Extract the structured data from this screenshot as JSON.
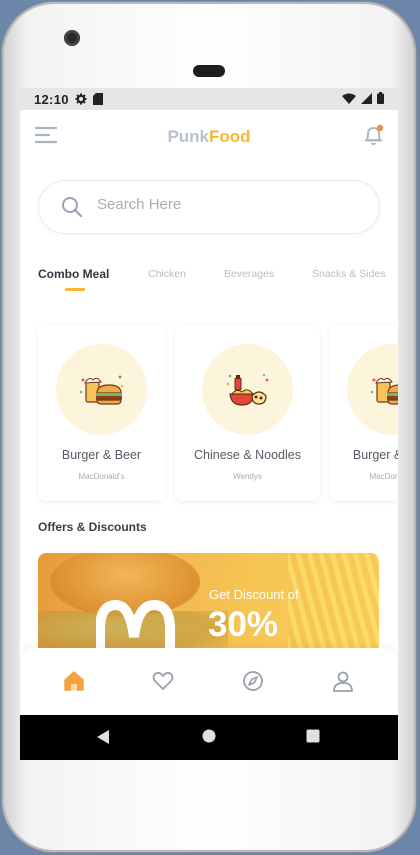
{
  "status_bar": {
    "time": "12:10",
    "icons": [
      "settings-icon",
      "sd-card-icon",
      "wifi-icon",
      "signal-icon",
      "battery-icon"
    ]
  },
  "header": {
    "brand_part1": "Punk",
    "brand_part2": "Food",
    "brand_colors": {
      "part1": "#b9c1cc",
      "part2": "#f7b733"
    },
    "left_icon": "menu-icon",
    "right_icon": "bell-icon",
    "notification_dot_color": "#f58b3c"
  },
  "search": {
    "placeholder": "Search Here",
    "value": ""
  },
  "tabs": [
    {
      "label": "Combo Meal",
      "active": true
    },
    {
      "label": "Chicken",
      "active": false
    },
    {
      "label": "Beverages",
      "active": false
    },
    {
      "label": "Snacks & Sides",
      "active": false
    }
  ],
  "cards": [
    {
      "title": "Burger & Beer",
      "subtitle": "MacDonald's",
      "icon": "burger-beer-icon"
    },
    {
      "title": "Chinese & Noodles",
      "subtitle": "Wendys",
      "icon": "chinese-noodles-icon"
    },
    {
      "title": "Burger & Beer",
      "subtitle": "MacDonald's",
      "icon": "burger-beer-icon"
    }
  ],
  "offers": {
    "section_title": "Offers & Discounts",
    "promo_text": "Get Discount of",
    "promo_value": "30%"
  },
  "bottom_nav": [
    {
      "icon": "home-icon",
      "active": true
    },
    {
      "icon": "heart-icon",
      "active": false
    },
    {
      "icon": "compass-icon",
      "active": false
    },
    {
      "icon": "profile-icon",
      "active": false
    }
  ],
  "colors": {
    "accent": "#f7b733",
    "nav_active": "#f5a142",
    "nav_inactive": "#9aa0aa"
  }
}
